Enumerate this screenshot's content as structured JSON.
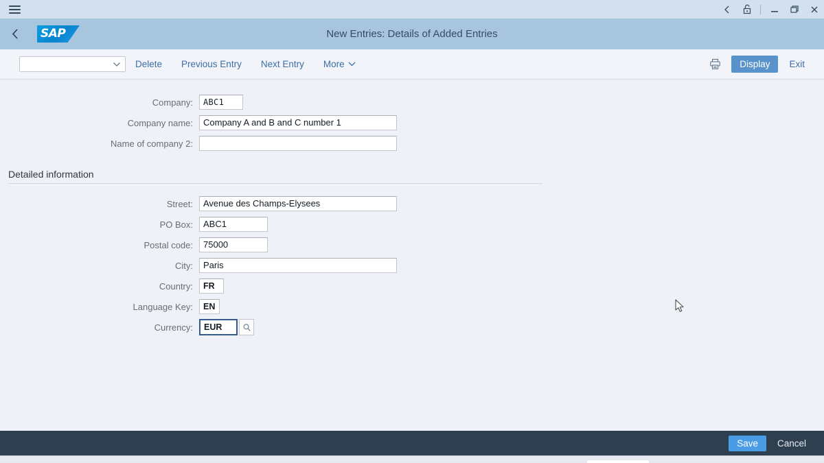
{
  "window": {
    "menu_icon": "hamburger-icon",
    "controls": [
      {
        "name": "back-icon",
        "glyph": "chevron-left"
      },
      {
        "name": "unlock-icon",
        "glyph": "padlock-open"
      },
      {
        "name": "minimize-icon",
        "glyph": "minimize"
      },
      {
        "name": "restore-icon",
        "glyph": "restore"
      },
      {
        "name": "close-icon",
        "glyph": "close"
      }
    ]
  },
  "shell": {
    "back_label": "<",
    "logo_text": "SAP",
    "page_title": "New Entries: Details of Added Entries"
  },
  "toolbar": {
    "entry_select_value": "",
    "entry_select_placeholder": "",
    "delete_label": "Delete",
    "previous_entry_label": "Previous Entry",
    "next_entry_label": "Next Entry",
    "more_label": "More",
    "print_icon": "printer-icon",
    "display_label": "Display",
    "exit_label": "Exit"
  },
  "form": {
    "top_fields": [
      {
        "label": "Company:",
        "value": "ABC1"
      },
      {
        "label": "Company name:",
        "value": "Company A and B and C number 1"
      },
      {
        "label": "Name of company 2:",
        "value": ""
      }
    ],
    "section_heading": "Detailed information",
    "detail_fields": [
      {
        "label": "Street:",
        "value": "Avenue des Champs-Elysees"
      },
      {
        "label": "PO Box:",
        "value": "ABC1"
      },
      {
        "label": "Postal code:",
        "value": "75000"
      },
      {
        "label": "City:",
        "value": "Paris"
      },
      {
        "label": "Country:",
        "value": "FR"
      },
      {
        "label": "Language Key:",
        "value": "EN"
      },
      {
        "label": "Currency:",
        "value": "EUR"
      }
    ],
    "currency_help_icon": "value-help-search-icon"
  },
  "footer": {
    "save_label": "Save",
    "cancel_label": "Cancel"
  },
  "colors": {
    "brand_blue": "#0a84d0",
    "shell_header": "#a8c5de",
    "window_chrome": "#d3e1ef",
    "toolbar_bg": "#f2f4f9",
    "content_bg": "#eef1f8",
    "footer_bg": "#2e3f4f",
    "accent_button": "#4a9de4",
    "display_button": "#5a93cb",
    "link_text": "#3b6ea5",
    "focus_border": "#345b8c"
  }
}
